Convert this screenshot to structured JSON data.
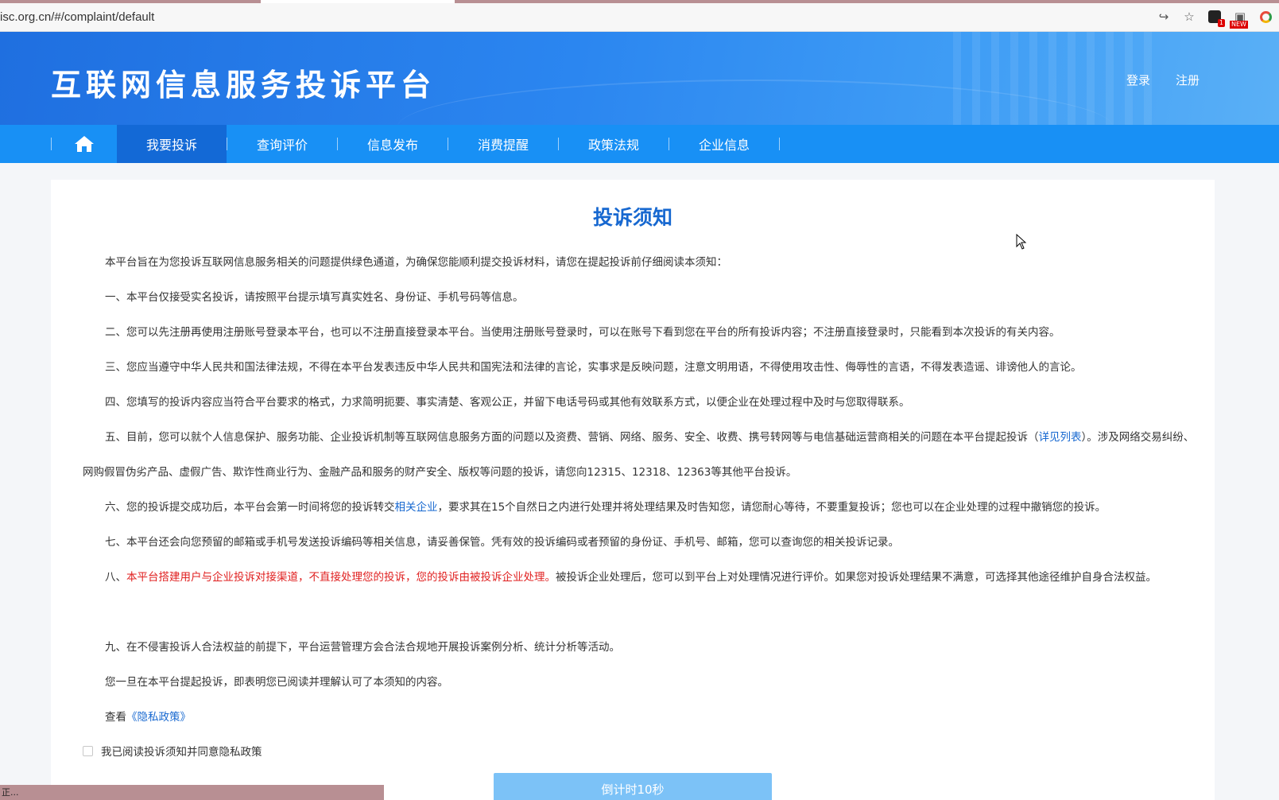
{
  "browser": {
    "url": "isc.org.cn/#/complaint/default",
    "status_text": "正...",
    "ext_badge_count": "1",
    "ext_new_label": "NEW"
  },
  "header": {
    "site_title": "互联网信息服务投诉平台",
    "login": "登录",
    "register": "注册"
  },
  "nav": {
    "items": [
      "我要投诉",
      "查询评价",
      "信息发布",
      "消费提醒",
      "政策法规",
      "企业信息"
    ],
    "active": "我要投诉"
  },
  "notice": {
    "title": "投诉须知",
    "intro": "本平台旨在为您投诉互联网信息服务相关的问题提供绿色通道，为确保您能顺利提交投诉材料，请您在提起投诉前仔细阅读本须知：",
    "p1": "一、本平台仅接受实名投诉，请按照平台提示填写真实姓名、身份证、手机号码等信息。",
    "p2": "二、您可以先注册再使用注册账号登录本平台，也可以不注册直接登录本平台。当使用注册账号登录时，可以在账号下看到您在平台的所有投诉内容；不注册直接登录时，只能看到本次投诉的有关内容。",
    "p3": "三、您应当遵守中华人民共和国法律法规，不得在本平台发表违反中华人民共和国宪法和法律的言论，实事求是反映问题，注意文明用语，不得使用攻击性、侮辱性的言语，不得发表造谣、诽谤他人的言论。",
    "p4": "四、您填写的投诉内容应当符合平台要求的格式，力求简明扼要、事实清楚、客观公正，并留下电话号码或其他有效联系方式，以便企业在处理过程中及时与您取得联系。",
    "p5_a": "五、目前，您可以就个人信息保护、服务功能、企业投诉机制等互联网信息服务方面的问题以及资费、营销、网络、服务、安全、收费、携号转网等与电信基础运营商相关的问题在本平台提起投诉（",
    "p5_link": "详见列表",
    "p5_b": "）。涉及网络交易纠纷、网购假冒伪劣产品、虚假广告、欺诈性商业行为、金融产品和服务的财产安全、版权等问题的投诉，请您向12315、12318、12363等其他平台投诉。",
    "p6_a": "六、您的投诉提交成功后，本平台会第一时间将您的投诉转交",
    "p6_link": "相关企业",
    "p6_b": "，要求其在15个自然日之内进行处理并将处理结果及时告知您，请您耐心等待，不要重复投诉；您也可以在企业处理的过程中撤销您的投诉。",
    "p7": "七、本平台还会向您预留的邮箱或手机号发送投诉编码等相关信息，请妥善保管。凭有效的投诉编码或者预留的身份证、手机号、邮箱，您可以查询您的相关投诉记录。",
    "p8_prefix": "八、",
    "p8_red": "本平台搭建用户与企业投诉对接渠道，不直接处理您的投诉，您的投诉由被投诉企业处理。",
    "p8_b": "被投诉企业处理后，您可以到平台上对处理情况进行评价。如果您对投诉处理结果不满意，可选择其他途径维护自身合法权益。",
    "p9": "九、在不侵害投诉人合法权益的前提下，平台运营管理方会合法合规地开展投诉案例分析、统计分析等活动。",
    "closing": "您一旦在本平台提起投诉，即表明您已阅读并理解认可了本须知的内容。",
    "privacy_prefix": "查看",
    "privacy_link": "《隐私政策》",
    "agree_label": "我已阅读投诉须知并同意隐私政策",
    "countdown": "倒计时10秒"
  }
}
